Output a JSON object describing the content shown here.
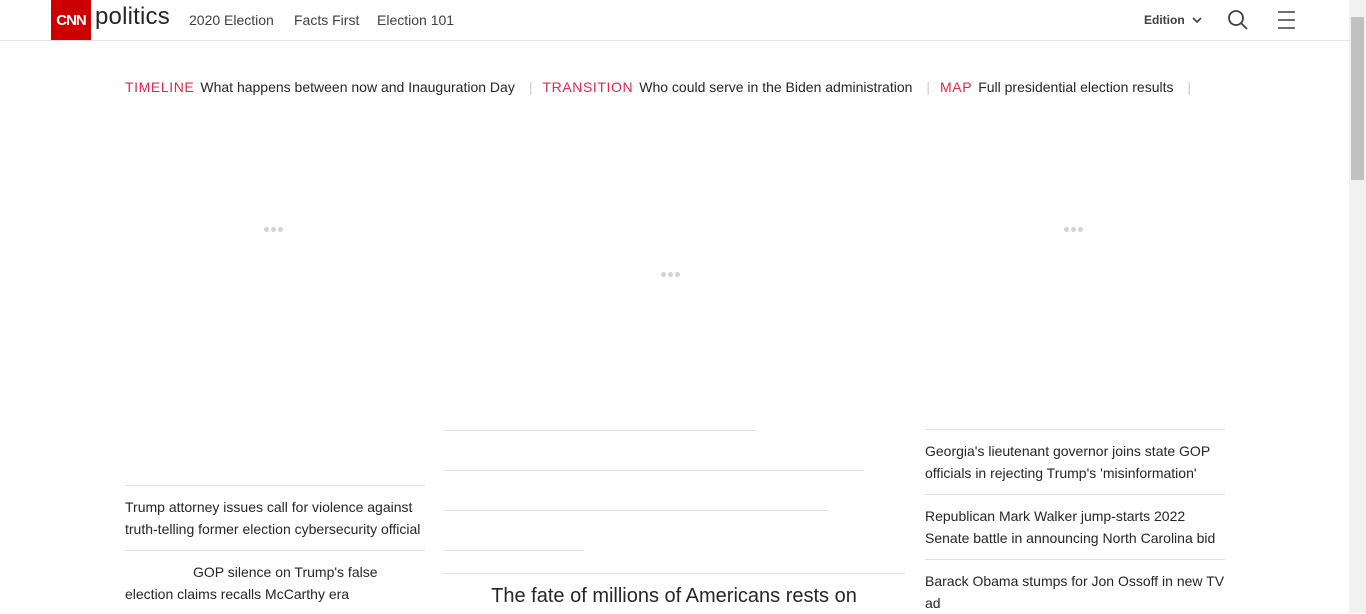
{
  "header": {
    "logo": "CNN",
    "section": "politics",
    "nav": [
      "2020 Election",
      "Facts First",
      "Election 101"
    ],
    "edition_label": "Edition"
  },
  "banner": [
    {
      "tag": "TIMELINE",
      "text": "What happens between now and Inauguration Day"
    },
    {
      "tag": "TRANSITION",
      "text": "Who could serve in the Biden administration"
    },
    {
      "tag": "MAP",
      "text": "Full presidential election results"
    }
  ],
  "left_column": [
    "Trump attorney issues call for violence against truth-telling former election cybersecurity official",
    "GOP silence on Trump's false election claims recalls McCarthy era"
  ],
  "right_column": [
    "Georgia's lieutenant governor joins state GOP officials in rejecting Trump's 'misinformation'",
    "Republican Mark Walker jump-starts 2022 Senate battle in announcing North Carolina bid",
    "Barack Obama stumps for Jon Ossoff in new TV ad"
  ],
  "center": {
    "headline": "The fate of millions of Americans rests on"
  },
  "colors": {
    "brand": "#cc0000",
    "banner_tag": "#e0284c"
  }
}
